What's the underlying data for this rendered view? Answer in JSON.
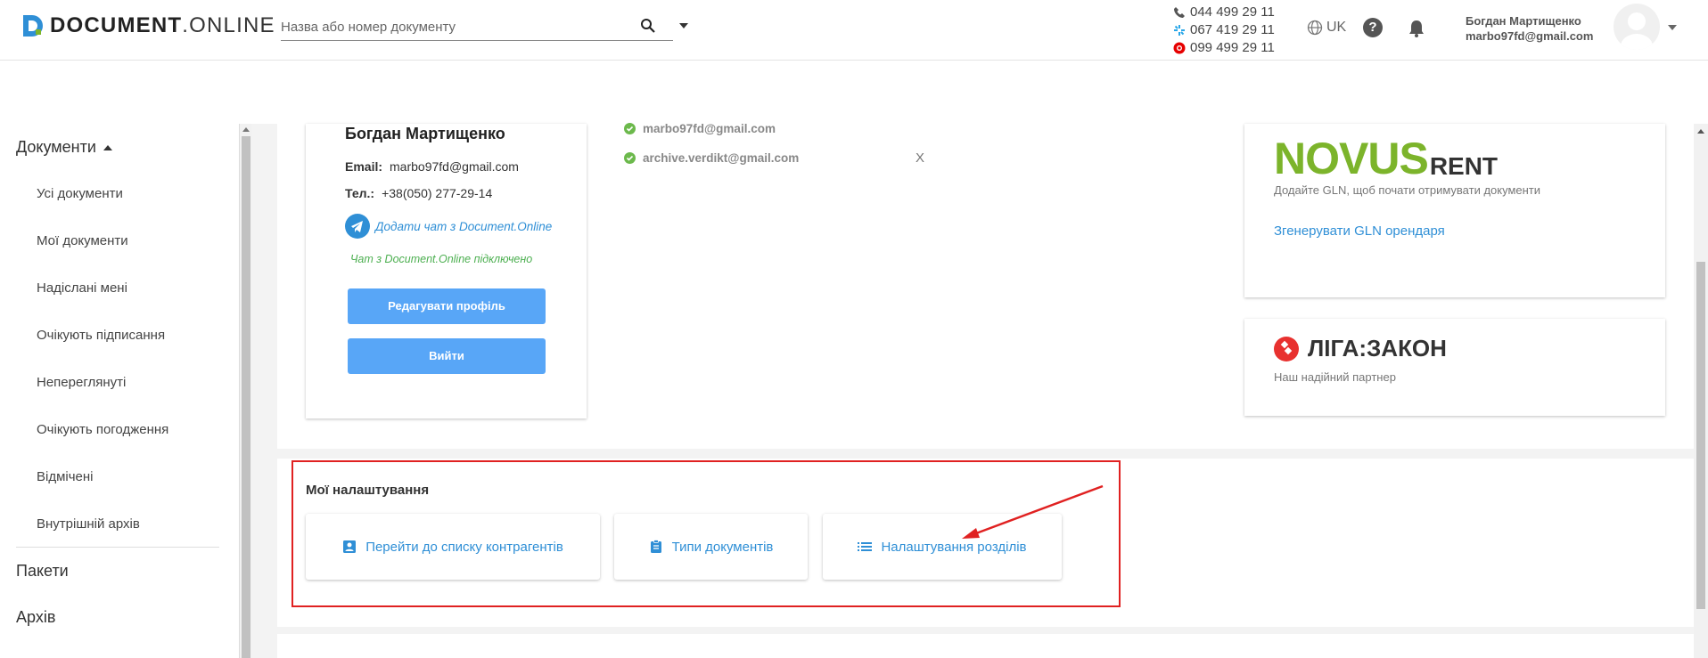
{
  "header": {
    "logo_brand": "DOCUMENT",
    "logo_dot": ".",
    "logo_suffix": "ONLINE",
    "search_placeholder": "Назва або номер документу",
    "phones": [
      "044 499 29 11",
      "067 419 29 11",
      "099 499 29 11"
    ],
    "language": "UK",
    "user_name": "Богдан Мартищенко",
    "user_email": "marbo97fd@gmail.com"
  },
  "sidebar": {
    "documents_label": "Документи",
    "sub_items": [
      "Усі документи",
      "Мої документи",
      "Надіслані мені",
      "Очікують підписання",
      "Непереглянуті",
      "Очікують погодження",
      "Відмічені",
      "Внутрішній архів"
    ],
    "packages_label": "Пакети",
    "archive_label": "Архів"
  },
  "profile": {
    "name": "Богдан Мартищенко",
    "email_label": "Email:",
    "email_value": "marbo97fd@gmail.com",
    "phone_label": "Тел.:",
    "phone_value": "+38(050) 277-29-14",
    "telegram_link": "Додати чат з Document.Online",
    "telegram_status": "Чат з Document.Online підключено",
    "edit_button": "Редагувати профіль",
    "logout_button": "Вийти"
  },
  "emails": {
    "items": [
      "marbo97fd@gmail.com",
      "archive.verdikt@gmail.com"
    ],
    "remove_label": "X"
  },
  "novus": {
    "logo_main": "NOVUS",
    "logo_sub": "RENT",
    "description": "Додайте GLN, щоб почати отримувати документи",
    "link": "Згенерувати GLN орендаря"
  },
  "liga": {
    "logo_text": "ЛІГА:ЗАКОН",
    "description": "Наш надійний партнер"
  },
  "settings": {
    "title": "Мої налаштування",
    "counterparties_button": "Перейти до списку контрагентів",
    "doc_types_button": "Типи документів",
    "sections_button": "Налаштування розділів"
  },
  "colors": {
    "accent": "#2f8fd6",
    "button_blue": "#58a6f7",
    "highlight_red": "#e02121",
    "novus_green": "#7cb42b",
    "status_green": "#4caf50"
  }
}
